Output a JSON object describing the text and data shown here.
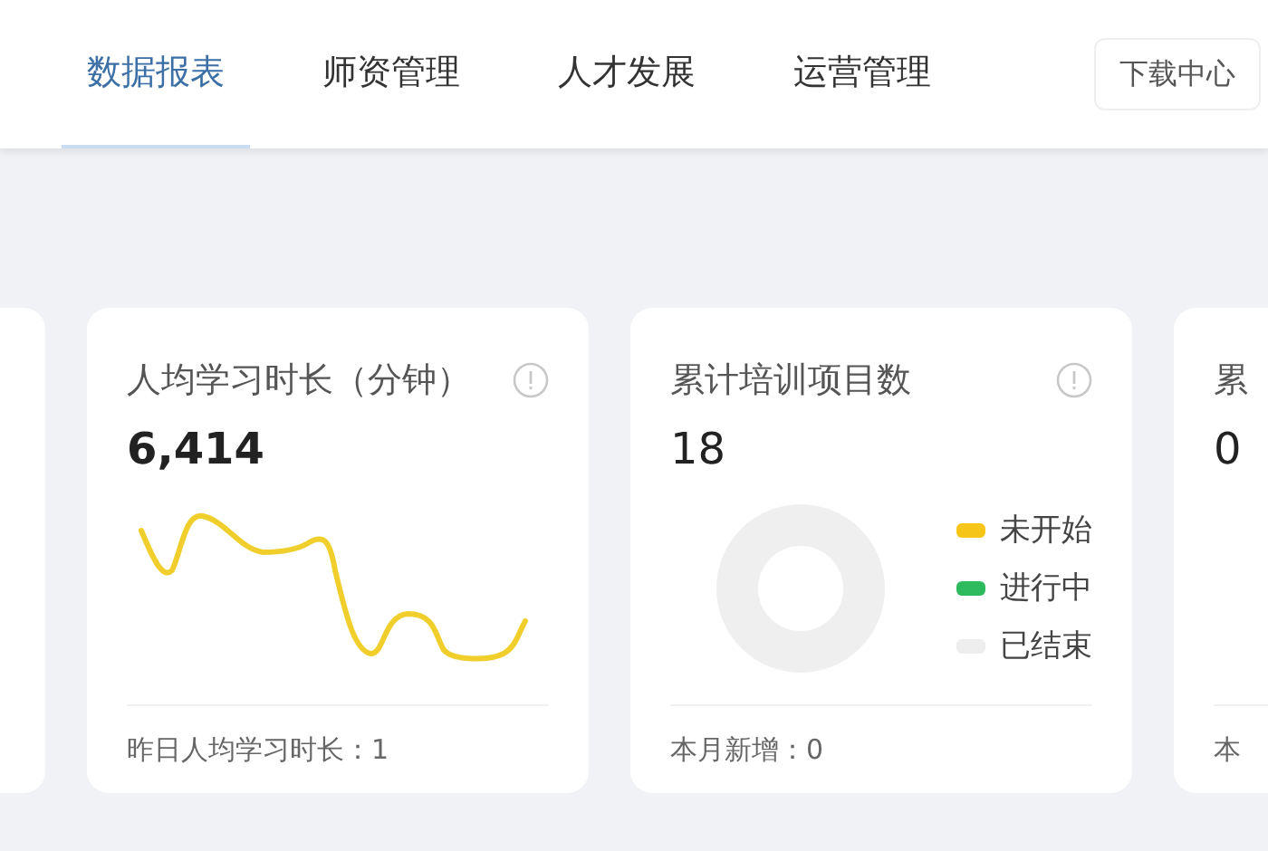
{
  "nav": {
    "tabs": [
      {
        "label": "数据报表",
        "selected": true
      },
      {
        "label": "师资管理",
        "selected": false
      },
      {
        "label": "人才发展",
        "selected": false
      },
      {
        "label": "运营管理",
        "selected": false
      }
    ],
    "download_button": "下载中心"
  },
  "cards": [
    {
      "kind": "sparkline",
      "title": "人均学习时长（分钟）",
      "value": "6,414",
      "footer": "昨日人均学习时长：1"
    },
    {
      "kind": "donut",
      "title": "累计培训项目数",
      "value": "18",
      "legend": [
        {
          "label": "未开始",
          "color": "#f5c518"
        },
        {
          "label": "进行中",
          "color": "#2dbb5d"
        },
        {
          "label": "已结束",
          "color": "#eeeeee"
        }
      ],
      "footer": "本月新增：0"
    },
    {
      "kind": "partial",
      "title": "累",
      "value": "0",
      "footer": "本"
    }
  ]
}
